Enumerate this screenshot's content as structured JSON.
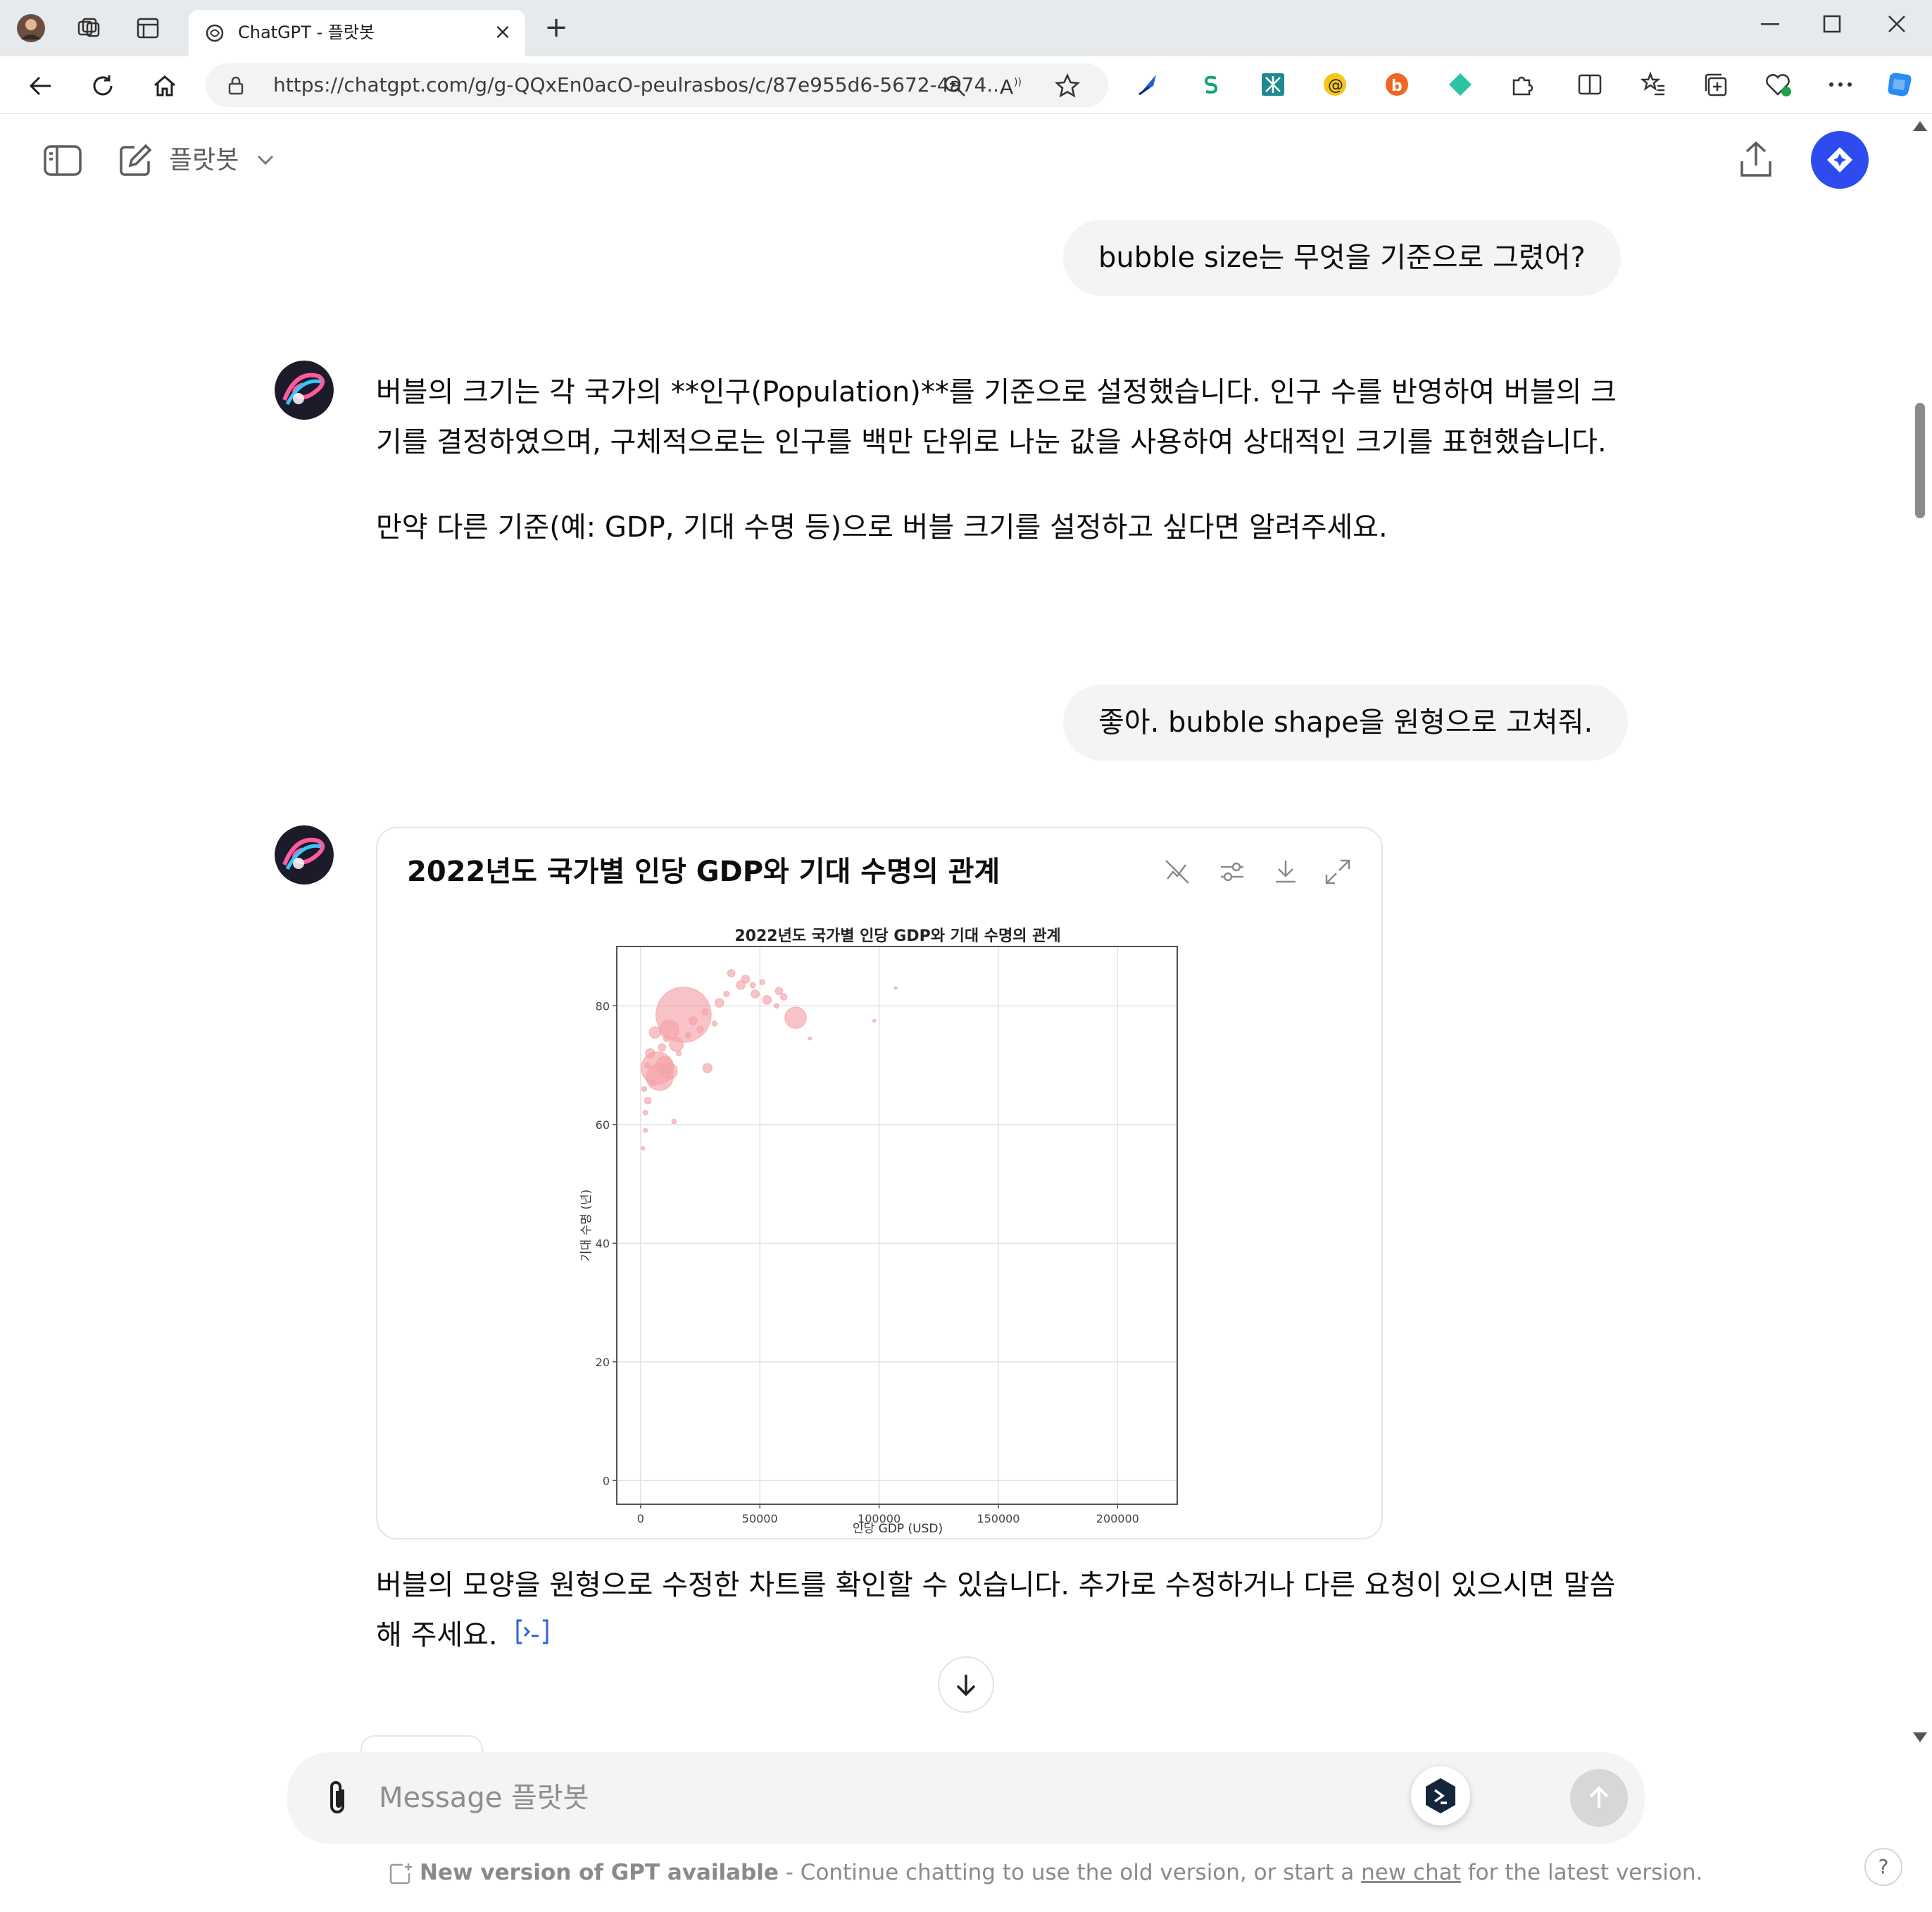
{
  "browser": {
    "tab_title": "ChatGPT - 플랏봇",
    "url": "https://chatgpt.com/g/g-QQxEn0acO-peulrasbos/c/87e955d6-5672-4a74..."
  },
  "header": {
    "model_name": "플랏봇"
  },
  "conversation": {
    "user_msg_1": "bubble size는 무엇을 기준으로 그렸어?",
    "assistant_msg_1_p1": "버블의 크기는 각 국가의 **인구(Population)**를 기준으로 설정했습니다. 인구 수를 반영하여 버블의 크기를 결정하였으며, 구체적으로는 인구를 백만 단위로 나눈 값을 사용하여 상대적인 크기를 표현했습니다.",
    "assistant_msg_1_p2": "만약 다른 기준(예: GDP, 기대 수명 등)으로 버블 크기를 설정하고 싶다면 알려주세요.",
    "user_msg_2": "좋아. bubble shape을 원형으로 고쳐줘.",
    "chart_card_title": "2022년도 국가별 인당 GDP와 기대 수명의 관계",
    "assistant_msg_2": "버블의 모양을 원형으로 수정한 차트를 확인할 수 있습니다. 추가로 수정하거나 다른 요청이 있으시면 말씀해 주세요."
  },
  "composer": {
    "placeholder": "Message 플랏봇"
  },
  "footer": {
    "bold": "New version of GPT available",
    "text_before_link": " - Continue chatting to use the old version, or start a ",
    "link": "new chat",
    "text_after_link": " for the latest version.",
    "help": "?"
  },
  "colors": {
    "bubble": "#f4a3a8",
    "accent": "#2e4bf0",
    "user_bubble_bg": "#f4f4f4"
  },
  "chart_data": {
    "type": "scatter",
    "title": "2022년도 국가별 인당 GDP와 기대 수명의 관계",
    "xlabel": "인당 GDP (USD)",
    "ylabel": "기대 수명 (년)",
    "xlim": [
      -10000,
      225000
    ],
    "ylim": [
      -4,
      90
    ],
    "xticks": [
      0,
      50000,
      100000,
      150000,
      200000
    ],
    "yticks": [
      0,
      20,
      40,
      60,
      80
    ],
    "grid": true,
    "bubble_size_encoding": "population",
    "points": [
      {
        "x": 18000,
        "y": 78.5,
        "size": 1400
      },
      {
        "x": 65000,
        "y": 78,
        "size": 210
      },
      {
        "x": 8000,
        "y": 68,
        "size": 330
      },
      {
        "x": 7000,
        "y": 69.5,
        "size": 480
      },
      {
        "x": 12000,
        "y": 69,
        "size": 120
      },
      {
        "x": 12000,
        "y": 76,
        "size": 170
      },
      {
        "x": 15000,
        "y": 73.5,
        "size": 90
      },
      {
        "x": 6000,
        "y": 75.5,
        "size": 60
      },
      {
        "x": 10000,
        "y": 70,
        "size": 140
      },
      {
        "x": 4000,
        "y": 72,
        "size": 40
      },
      {
        "x": 28000,
        "y": 69.5,
        "size": 40
      },
      {
        "x": 33000,
        "y": 80.5,
        "size": 35
      },
      {
        "x": 42000,
        "y": 83.5,
        "size": 35
      },
      {
        "x": 48000,
        "y": 82,
        "size": 30
      },
      {
        "x": 53000,
        "y": 81,
        "size": 35
      },
      {
        "x": 58000,
        "y": 82.5,
        "size": 25
      },
      {
        "x": 44000,
        "y": 84.5,
        "size": 30
      },
      {
        "x": 38000,
        "y": 85.5,
        "size": 25
      },
      {
        "x": 60000,
        "y": 81.5,
        "size": 20
      },
      {
        "x": 22000,
        "y": 77.5,
        "size": 30
      },
      {
        "x": 25000,
        "y": 76,
        "size": 20
      },
      {
        "x": 3000,
        "y": 64,
        "size": 20
      },
      {
        "x": 2000,
        "y": 62,
        "size": 10
      },
      {
        "x": 2000,
        "y": 59,
        "size": 8
      },
      {
        "x": 1000,
        "y": 56,
        "size": 6
      },
      {
        "x": 1500,
        "y": 66,
        "size": 12
      },
      {
        "x": 3000,
        "y": 70,
        "size": 15
      },
      {
        "x": 5000,
        "y": 67,
        "size": 18
      },
      {
        "x": 9000,
        "y": 73,
        "size": 25
      },
      {
        "x": 11000,
        "y": 74.5,
        "size": 20
      },
      {
        "x": 14000,
        "y": 60.5,
        "size": 10
      },
      {
        "x": 16000,
        "y": 72,
        "size": 12
      },
      {
        "x": 20000,
        "y": 75,
        "size": 15
      },
      {
        "x": 27000,
        "y": 79,
        "size": 18
      },
      {
        "x": 31000,
        "y": 77,
        "size": 12
      },
      {
        "x": 36000,
        "y": 82,
        "size": 15
      },
      {
        "x": 47000,
        "y": 83.5,
        "size": 14
      },
      {
        "x": 51000,
        "y": 84,
        "size": 12
      },
      {
        "x": 57000,
        "y": 80,
        "size": 10
      },
      {
        "x": 71000,
        "y": 74.5,
        "size": 5
      },
      {
        "x": 98000,
        "y": 77.5,
        "size": 4
      },
      {
        "x": 107000,
        "y": 83,
        "size": 4
      }
    ]
  }
}
